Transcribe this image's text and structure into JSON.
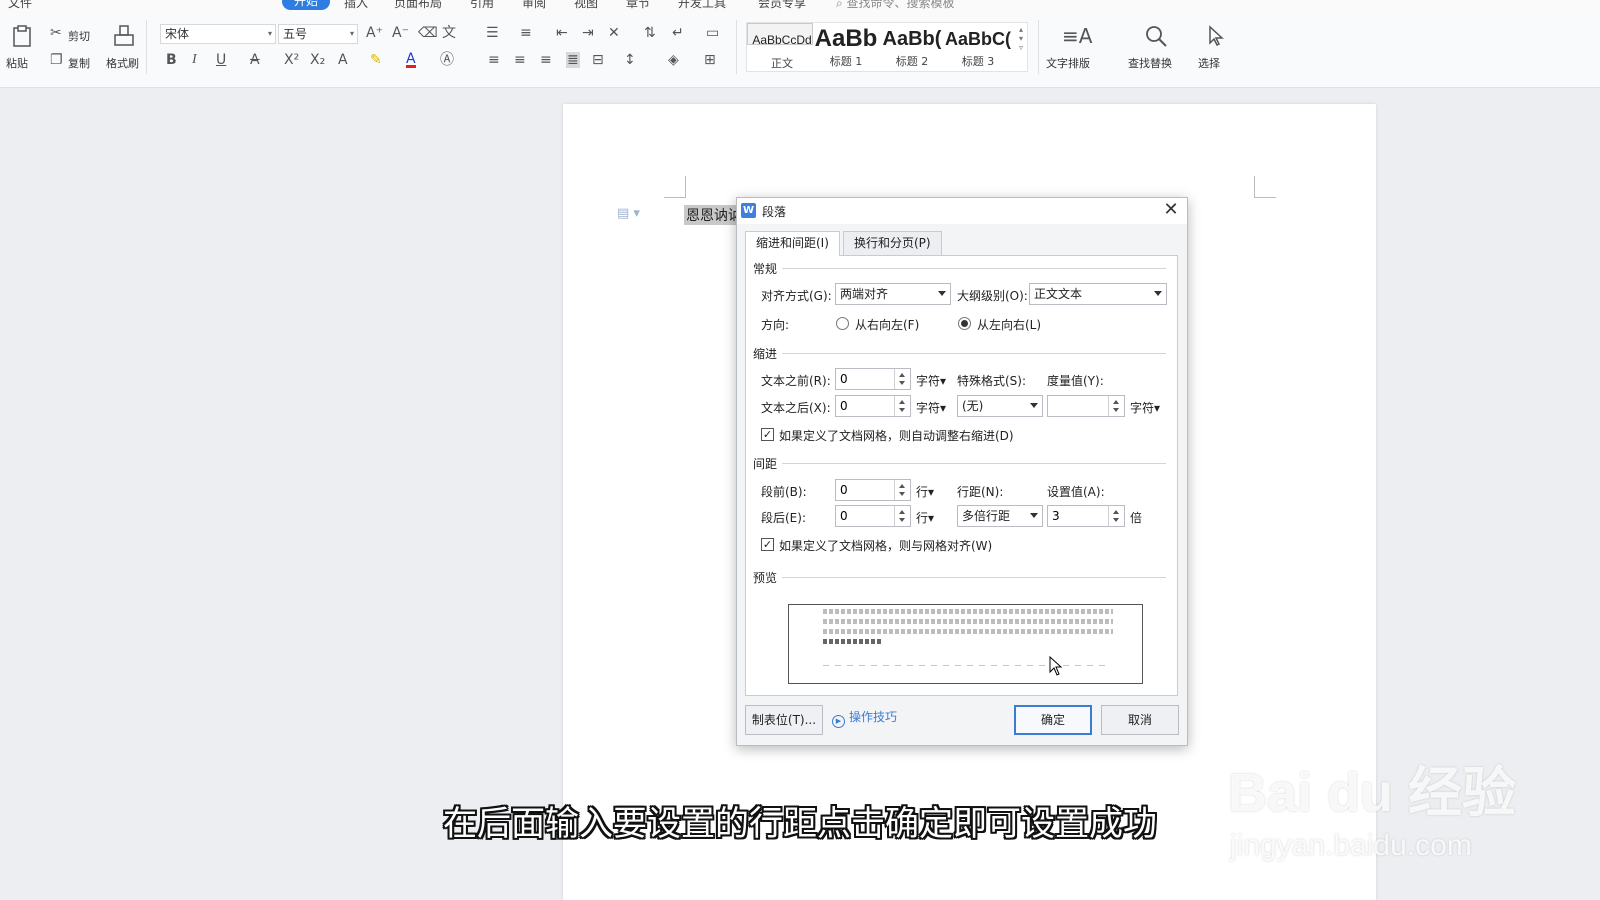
{
  "menu": {
    "file": "文件",
    "home": "开始",
    "insert": "插入",
    "layout": "页面布局",
    "references": "引用",
    "review": "审阅",
    "view": "视图",
    "chapter": "章节",
    "developer": "开发工具",
    "member": "会员专享",
    "search_placeholder": "查找命令、搜索模板"
  },
  "ribbon": {
    "paste": "粘贴",
    "cut": "剪切",
    "copy": "复制",
    "format_painter": "格式刷",
    "font_name": "宋体",
    "font_size": "五号",
    "styles": [
      {
        "sample": "AaBbCcDd",
        "label": "正文"
      },
      {
        "sample": "AaBb",
        "label": "标题 1"
      },
      {
        "sample": "AaBb(",
        "label": "标题 2"
      },
      {
        "sample": "AaBbC(",
        "label": "标题 3"
      }
    ],
    "text_layout": "文字排版",
    "find_replace": "查找替换",
    "select": "选择"
  },
  "document": {
    "text": "恩恩讷讷"
  },
  "dialog": {
    "title": "段落",
    "tabs": [
      "缩进和间距(I)",
      "换行和分页(P)"
    ],
    "general": {
      "section": "常规",
      "align_label": "对齐方式(G):",
      "align_value": "两端对齐",
      "outline_label": "大纲级别(O):",
      "outline_value": "正文文本",
      "direction_label": "方向:",
      "rtl": "从右向左(F)",
      "ltr": "从左向右(L)"
    },
    "indent": {
      "section": "缩进",
      "before_label": "文本之前(R):",
      "before_value": "0",
      "after_label": "文本之后(X):",
      "after_value": "0",
      "unit": "字符",
      "special_label": "特殊格式(S):",
      "special_value": "(无)",
      "measure_label": "度量值(Y):",
      "measure_value": "",
      "measure_unit": "字符",
      "auto_adjust": "如果定义了文档网格，则自动调整右缩进(D)"
    },
    "spacing": {
      "section": "间距",
      "before_label": "段前(B):",
      "before_value": "0",
      "after_label": "段后(E):",
      "after_value": "0",
      "unit": "行",
      "line_label": "行距(N):",
      "line_value": "多倍行距",
      "setting_label": "设置值(A):",
      "setting_value": "3",
      "setting_unit": "倍",
      "snap_grid": "如果定义了文档网格，则与网格对齐(W)"
    },
    "preview": {
      "section": "预览"
    },
    "buttons": {
      "tabs": "制表位(T)...",
      "tips": "操作技巧",
      "ok": "确定",
      "cancel": "取消"
    }
  },
  "overlay": {
    "subtitle": "在后面输入要设置的行距点击确定即可设置成功",
    "watermark_logo": "Bai du 经验",
    "watermark_url": "jingyan.baidu.com"
  }
}
